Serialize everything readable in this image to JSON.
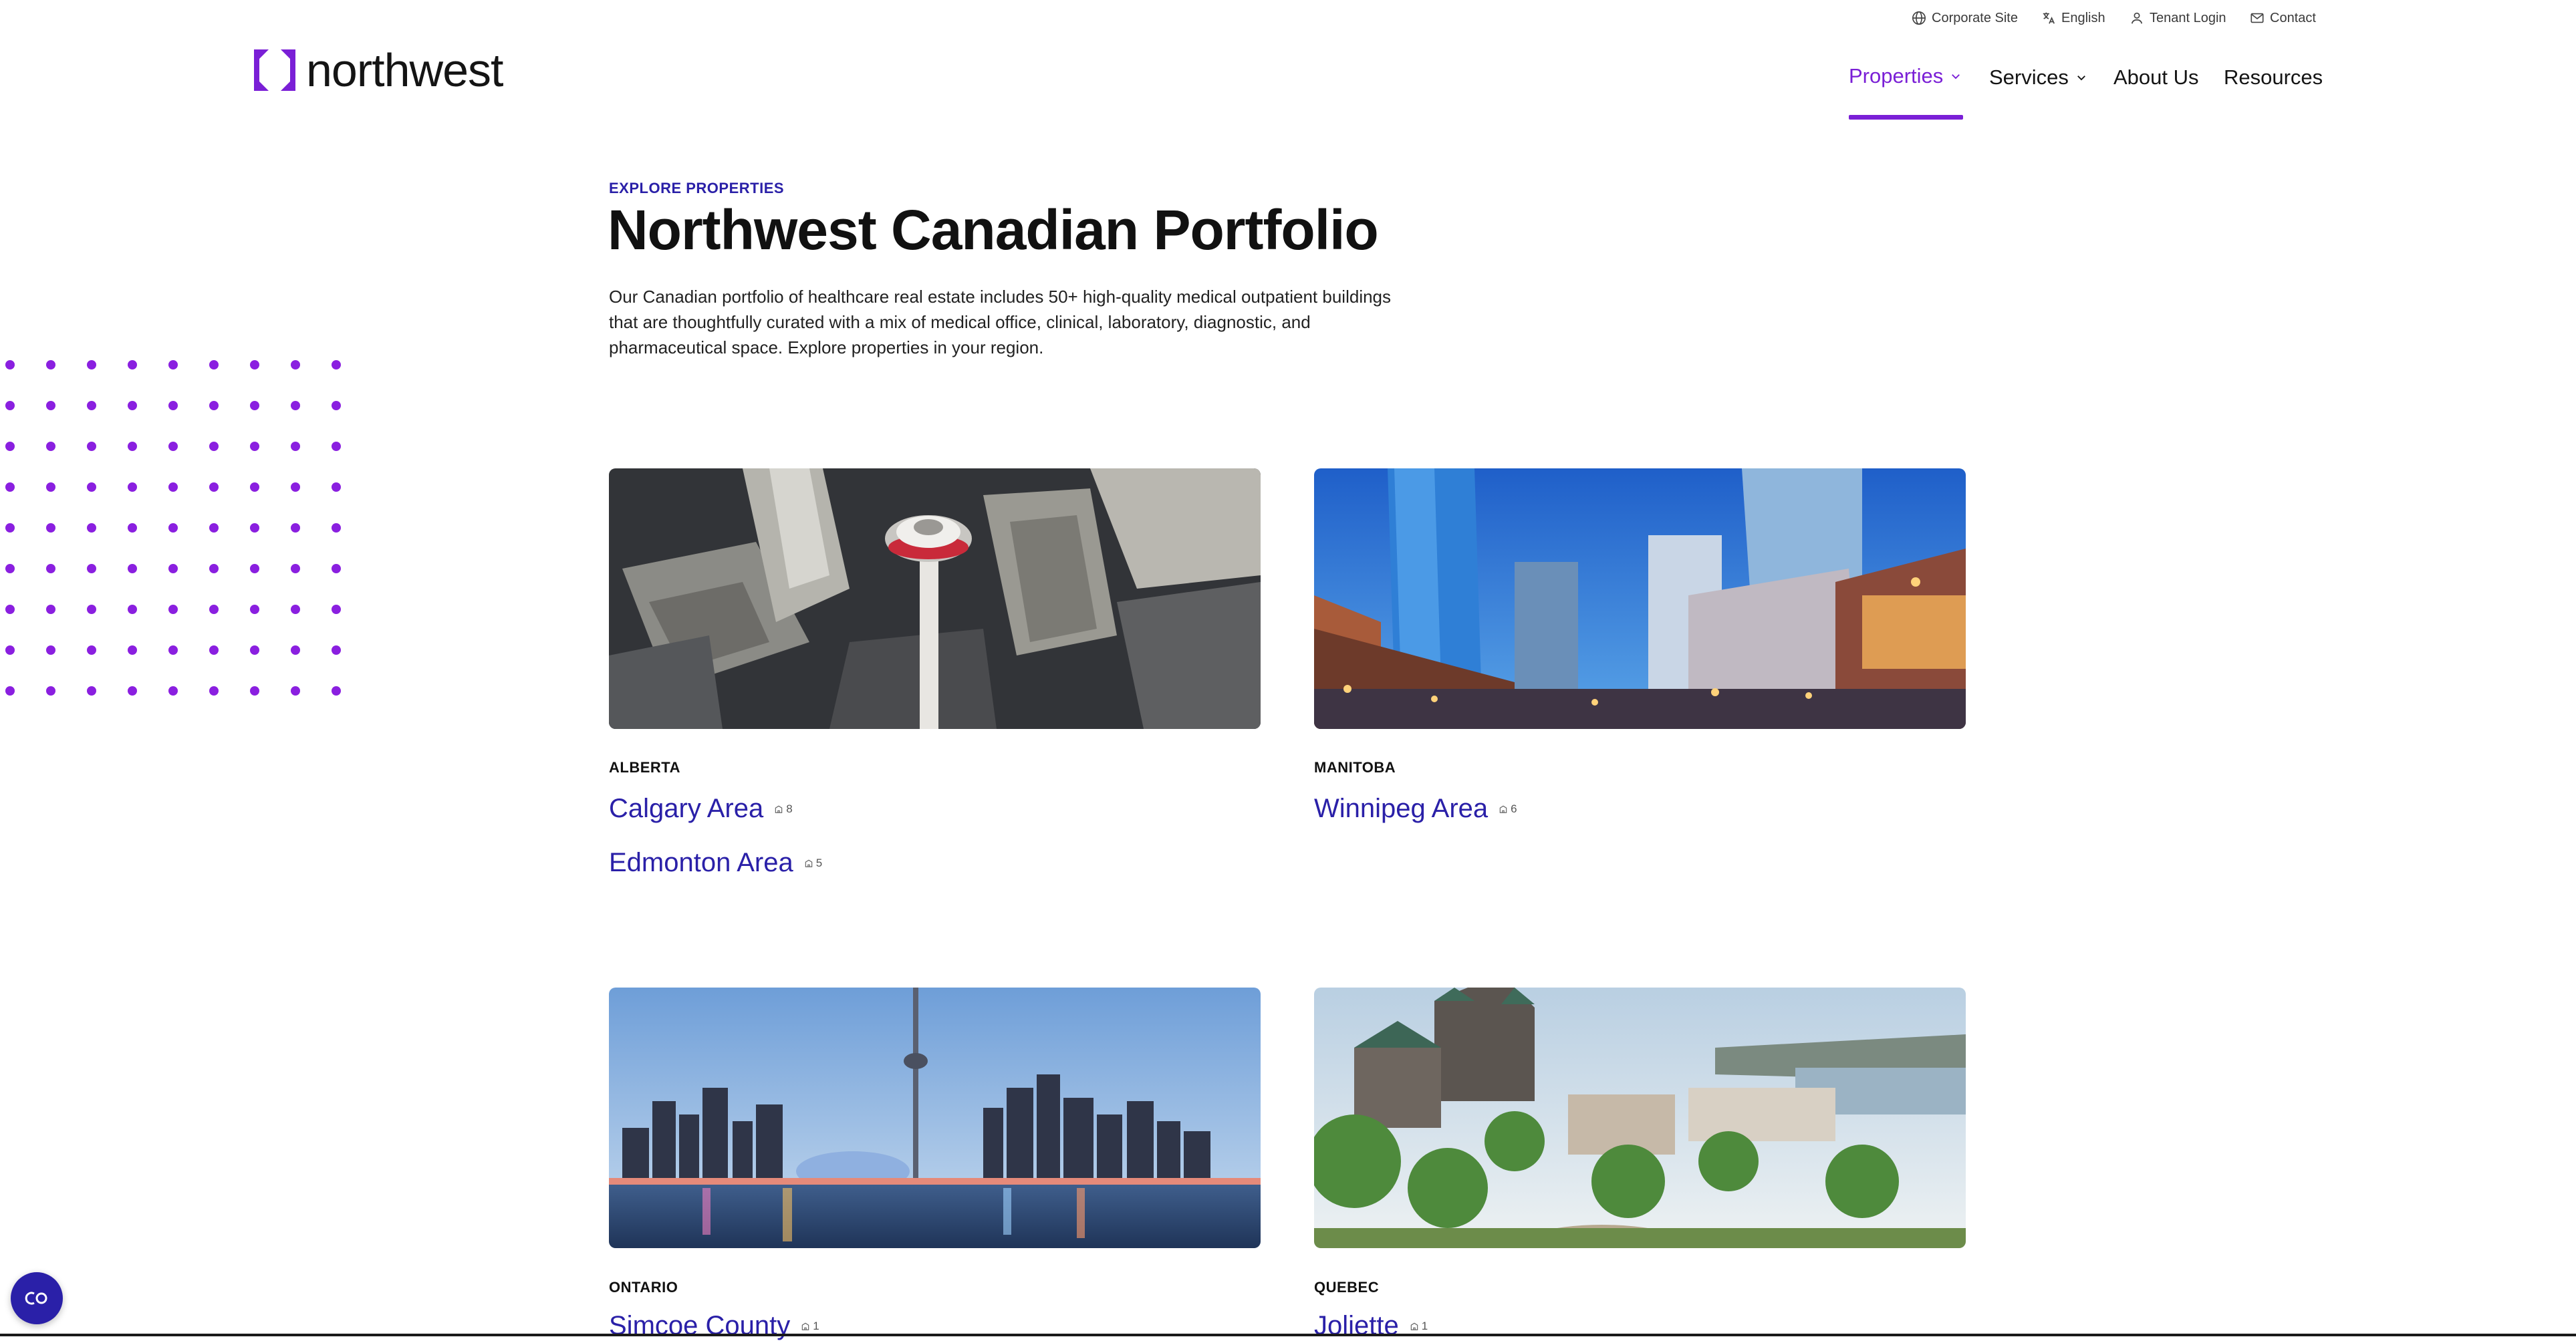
{
  "utility_nav": {
    "corporate_site": "Corporate Site",
    "language": "English",
    "tenant_login": "Tenant Login",
    "contact": "Contact"
  },
  "brand": {
    "name": "northwest",
    "accent_color": "#7a1fd6",
    "link_color": "#2a20a8"
  },
  "main_nav": {
    "properties": "Properties",
    "services": "Services",
    "about": "About Us",
    "resources": "Resources"
  },
  "intro": {
    "eyebrow": "EXPLORE PROPERTIES",
    "title": "Northwest Canadian Portfolio",
    "description": "Our Canadian portfolio of healthcare real estate includes 50+ high-quality medical outpatient buildings that are thoughtfully curated with a mix of medical office, clinical, laboratory, diagnostic, and pharmaceutical space. Explore properties in your region."
  },
  "regions": [
    {
      "province": "ALBERTA",
      "image": "calgary-tower-aerial-photo",
      "areas": [
        {
          "name": "Calgary Area",
          "count": "8"
        },
        {
          "name": "Edmonton Area",
          "count": "5"
        }
      ]
    },
    {
      "province": "MANITOBA",
      "image": "winnipeg-downtown-dusk-photo",
      "areas": [
        {
          "name": "Winnipeg Area",
          "count": "6"
        }
      ]
    },
    {
      "province": "ONTARIO",
      "image": "toronto-skyline-photo",
      "areas": [
        {
          "name": "Simcoe County",
          "count": "1"
        }
      ]
    },
    {
      "province": "QUEBEC",
      "image": "quebec-city-chateau-photo",
      "areas": [
        {
          "name": "Joliette",
          "count": "1"
        }
      ]
    }
  ],
  "chat_widget": {
    "icon": "chat-bubble-icon"
  }
}
